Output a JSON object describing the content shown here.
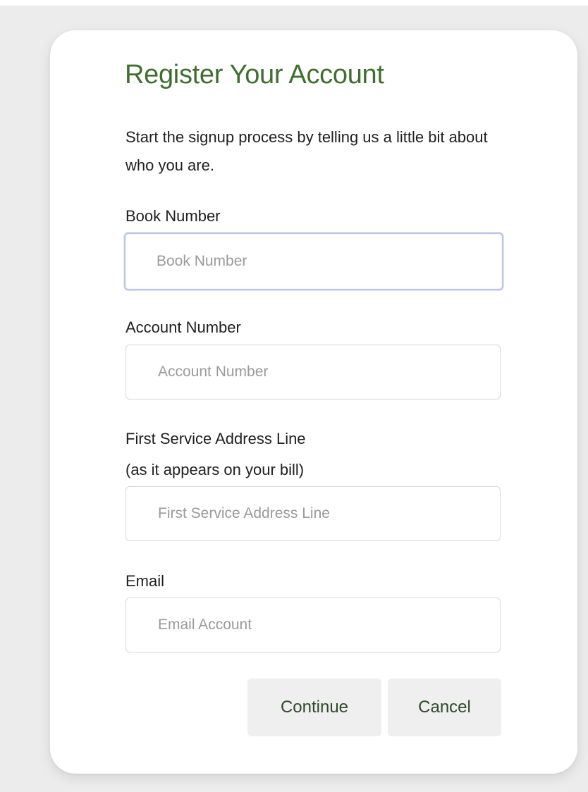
{
  "form": {
    "title": "Register Your Account",
    "intro": "Start the signup process by telling us a little bit about who you are.",
    "book_number": {
      "label": "Book Number",
      "placeholder": "Book Number",
      "value": ""
    },
    "account_number": {
      "label": "Account Number",
      "placeholder": "Account Number",
      "value": ""
    },
    "service_address": {
      "label_line1": "First Service Address Line",
      "label_line2": "(as it appears on your bill)",
      "placeholder": "First Service Address Line",
      "value": ""
    },
    "email": {
      "label": "Email",
      "placeholder": "Email Account",
      "value": ""
    },
    "buttons": {
      "continue_label": "Continue",
      "cancel_label": "Cancel"
    }
  },
  "colors": {
    "page_background": "#ececec",
    "card_background": "#ffffff",
    "title": "#3f6f2e",
    "button_text": "#2e4a2a",
    "button_background": "#efefef",
    "focus_border": "#b9c6e6"
  }
}
